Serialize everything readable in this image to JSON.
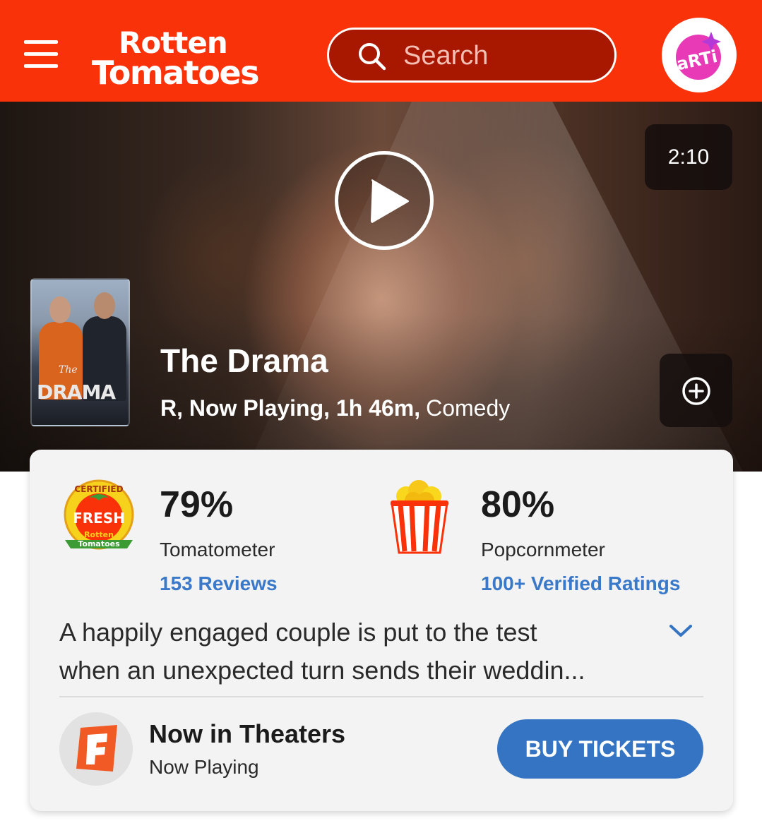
{
  "header": {
    "logo_line1": "Rotten",
    "logo_line2": "Tomatoes",
    "search_placeholder": "Search",
    "avatar_text": "aRTi",
    "brand_color": "#fa320a"
  },
  "hero": {
    "video_duration": "2:10",
    "poster_title": "DRAMA",
    "poster_title_prefix": "The",
    "title": "The Drama",
    "meta_bold": "R, Now Playing, 1h 46m,",
    "genre": "Comedy"
  },
  "scores": {
    "tomatometer": {
      "badge_certified": "CERTIFIED",
      "badge_fresh": "FRESH",
      "badge_brand1": "Rotten",
      "badge_brand2": "Tomatoes",
      "value": "79%",
      "label": "Tomatometer",
      "reviews": "153 Reviews"
    },
    "popcornmeter": {
      "value": "80%",
      "label": "Popcornmeter",
      "ratings": "100+ Verified Ratings"
    }
  },
  "synopsis": {
    "line1": "A happily engaged couple is put to the test",
    "line2": "when an unexpected turn sends their weddin..."
  },
  "theaters": {
    "title": "Now in Theaters",
    "subtitle": "Now Playing",
    "button": "BUY TICKETS",
    "button_color": "#3474c2"
  }
}
